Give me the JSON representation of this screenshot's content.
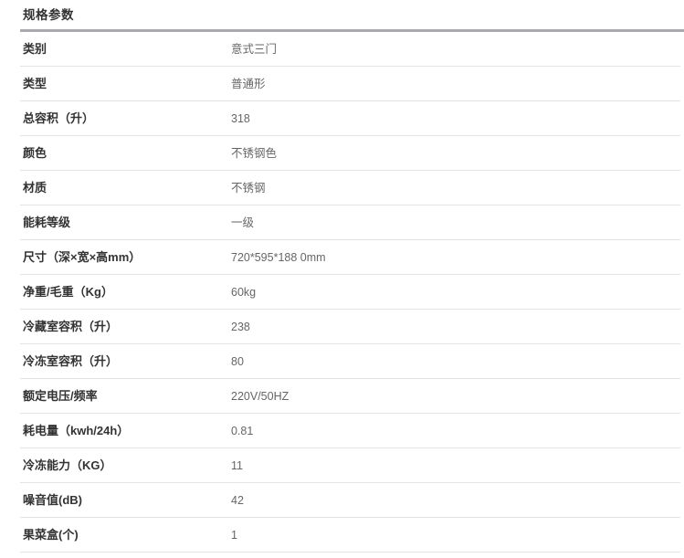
{
  "section": {
    "title": "规格参数",
    "rule_color": "#a9aaad",
    "row_divider_color": "#e3e3e3",
    "label_color": "#333333",
    "value_color": "#666666"
  },
  "specs": [
    {
      "label": "类别",
      "value": "意式三门"
    },
    {
      "label": "类型",
      "value": "普通形"
    },
    {
      "label": "总容积（升）",
      "value": "318"
    },
    {
      "label": "颜色",
      "value": "不锈钢色"
    },
    {
      "label": "材质",
      "value": "不锈钢"
    },
    {
      "label": "能耗等级",
      "value": "一级"
    },
    {
      "label": "尺寸（深×宽×高mm）",
      "value": "720*595*188 0mm"
    },
    {
      "label": "净重/毛重（Kg）",
      "value": "60kg"
    },
    {
      "label": "冷藏室容积（升）",
      "value": "238"
    },
    {
      "label": "冷冻室容积（升）",
      "value": "80"
    },
    {
      "label": "额定电压/频率",
      "value": "220V/50HZ"
    },
    {
      "label": "耗电量（kwh/24h）",
      "value": "0.81"
    },
    {
      "label": "冷冻能力（KG）",
      "value": "11"
    },
    {
      "label": "噪音值(dB)",
      "value": "42"
    },
    {
      "label": "果菜盒(个)",
      "value": "1"
    }
  ]
}
